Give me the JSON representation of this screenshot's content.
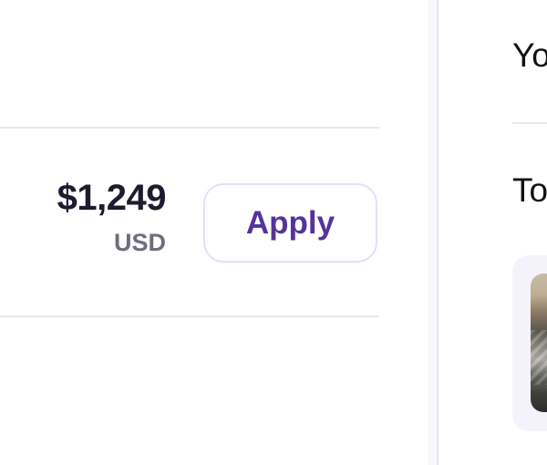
{
  "listing": {
    "price": "$1,249",
    "currency": "USD",
    "apply_label": "Apply"
  },
  "sidebar": {
    "title": "Yo",
    "subtitle": "To"
  },
  "colors": {
    "accent": "#55339b",
    "price_text": "#1f1b2e",
    "muted_text": "#6f6d7c",
    "button_border": "#e5e0f7",
    "divider": "#e9e8f0",
    "card_background": "#f4f3fb"
  }
}
